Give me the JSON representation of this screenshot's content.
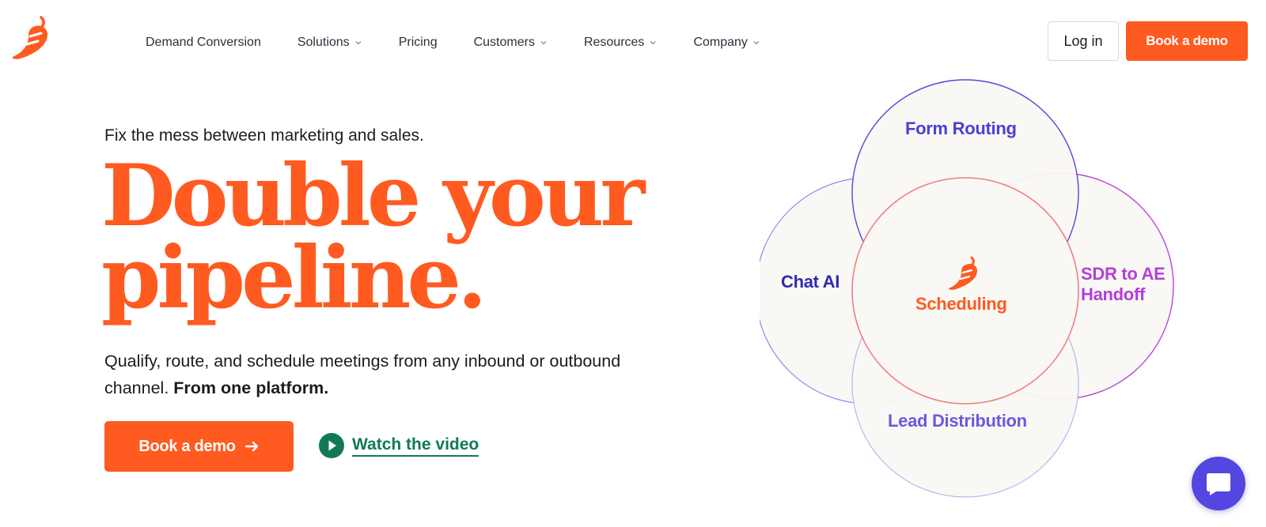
{
  "nav": {
    "logo_icon": "pepper-logo-icon",
    "items": [
      {
        "label": "Demand Conversion",
        "dropdown": false
      },
      {
        "label": "Solutions",
        "dropdown": true
      },
      {
        "label": "Pricing",
        "dropdown": false
      },
      {
        "label": "Customers",
        "dropdown": true
      },
      {
        "label": "Resources",
        "dropdown": true
      },
      {
        "label": "Company",
        "dropdown": true
      }
    ],
    "login_label": "Log in",
    "demo_label": "Book a demo"
  },
  "hero": {
    "eyebrow": "Fix the mess between marketing and sales.",
    "headline_line1": "Double your",
    "headline_line2": "pipeline.",
    "sub_text": "Qualify, route, and schedule meetings from any inbound or outbound channel.",
    "sub_bold": "From one platform.",
    "cta_label": "Book a demo",
    "cta_icon": "arrow-right-icon",
    "video_label": "Watch the video",
    "video_icon": "play-icon"
  },
  "venn": {
    "top": "Form Routing",
    "left": "Chat AI",
    "center": "Scheduling",
    "right_line1": "SDR to AE",
    "right_line2": "Handoff",
    "bottom": "Lead Distribution"
  },
  "colors": {
    "brand": "#ff5a1f",
    "link_green": "#117a54",
    "indigo": "#4b3fd6",
    "purple": "#b43fdc",
    "chat_bg": "#5446e0"
  },
  "chat_widget_icon": "chat-bubble-icon"
}
